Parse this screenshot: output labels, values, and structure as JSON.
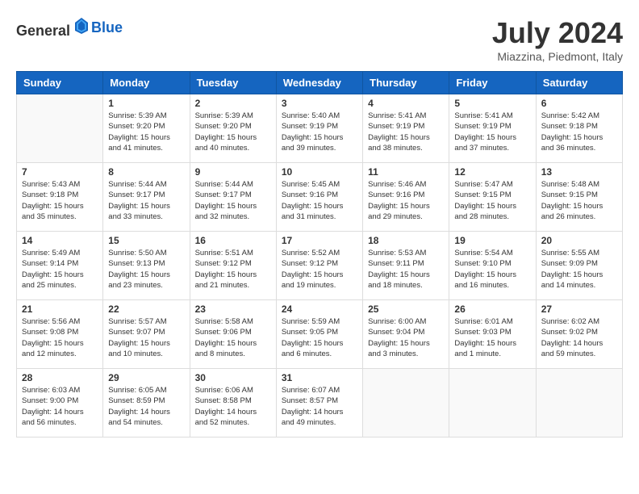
{
  "header": {
    "logo_general": "General",
    "logo_blue": "Blue",
    "month_year": "July 2024",
    "location": "Miazzina, Piedmont, Italy"
  },
  "columns": [
    "Sunday",
    "Monday",
    "Tuesday",
    "Wednesday",
    "Thursday",
    "Friday",
    "Saturday"
  ],
  "weeks": [
    [
      {
        "day": "",
        "info": ""
      },
      {
        "day": "1",
        "info": "Sunrise: 5:39 AM\nSunset: 9:20 PM\nDaylight: 15 hours\nand 41 minutes."
      },
      {
        "day": "2",
        "info": "Sunrise: 5:39 AM\nSunset: 9:20 PM\nDaylight: 15 hours\nand 40 minutes."
      },
      {
        "day": "3",
        "info": "Sunrise: 5:40 AM\nSunset: 9:19 PM\nDaylight: 15 hours\nand 39 minutes."
      },
      {
        "day": "4",
        "info": "Sunrise: 5:41 AM\nSunset: 9:19 PM\nDaylight: 15 hours\nand 38 minutes."
      },
      {
        "day": "5",
        "info": "Sunrise: 5:41 AM\nSunset: 9:19 PM\nDaylight: 15 hours\nand 37 minutes."
      },
      {
        "day": "6",
        "info": "Sunrise: 5:42 AM\nSunset: 9:18 PM\nDaylight: 15 hours\nand 36 minutes."
      }
    ],
    [
      {
        "day": "7",
        "info": "Sunrise: 5:43 AM\nSunset: 9:18 PM\nDaylight: 15 hours\nand 35 minutes."
      },
      {
        "day": "8",
        "info": "Sunrise: 5:44 AM\nSunset: 9:17 PM\nDaylight: 15 hours\nand 33 minutes."
      },
      {
        "day": "9",
        "info": "Sunrise: 5:44 AM\nSunset: 9:17 PM\nDaylight: 15 hours\nand 32 minutes."
      },
      {
        "day": "10",
        "info": "Sunrise: 5:45 AM\nSunset: 9:16 PM\nDaylight: 15 hours\nand 31 minutes."
      },
      {
        "day": "11",
        "info": "Sunrise: 5:46 AM\nSunset: 9:16 PM\nDaylight: 15 hours\nand 29 minutes."
      },
      {
        "day": "12",
        "info": "Sunrise: 5:47 AM\nSunset: 9:15 PM\nDaylight: 15 hours\nand 28 minutes."
      },
      {
        "day": "13",
        "info": "Sunrise: 5:48 AM\nSunset: 9:15 PM\nDaylight: 15 hours\nand 26 minutes."
      }
    ],
    [
      {
        "day": "14",
        "info": "Sunrise: 5:49 AM\nSunset: 9:14 PM\nDaylight: 15 hours\nand 25 minutes."
      },
      {
        "day": "15",
        "info": "Sunrise: 5:50 AM\nSunset: 9:13 PM\nDaylight: 15 hours\nand 23 minutes."
      },
      {
        "day": "16",
        "info": "Sunrise: 5:51 AM\nSunset: 9:12 PM\nDaylight: 15 hours\nand 21 minutes."
      },
      {
        "day": "17",
        "info": "Sunrise: 5:52 AM\nSunset: 9:12 PM\nDaylight: 15 hours\nand 19 minutes."
      },
      {
        "day": "18",
        "info": "Sunrise: 5:53 AM\nSunset: 9:11 PM\nDaylight: 15 hours\nand 18 minutes."
      },
      {
        "day": "19",
        "info": "Sunrise: 5:54 AM\nSunset: 9:10 PM\nDaylight: 15 hours\nand 16 minutes."
      },
      {
        "day": "20",
        "info": "Sunrise: 5:55 AM\nSunset: 9:09 PM\nDaylight: 15 hours\nand 14 minutes."
      }
    ],
    [
      {
        "day": "21",
        "info": "Sunrise: 5:56 AM\nSunset: 9:08 PM\nDaylight: 15 hours\nand 12 minutes."
      },
      {
        "day": "22",
        "info": "Sunrise: 5:57 AM\nSunset: 9:07 PM\nDaylight: 15 hours\nand 10 minutes."
      },
      {
        "day": "23",
        "info": "Sunrise: 5:58 AM\nSunset: 9:06 PM\nDaylight: 15 hours\nand 8 minutes."
      },
      {
        "day": "24",
        "info": "Sunrise: 5:59 AM\nSunset: 9:05 PM\nDaylight: 15 hours\nand 6 minutes."
      },
      {
        "day": "25",
        "info": "Sunrise: 6:00 AM\nSunset: 9:04 PM\nDaylight: 15 hours\nand 3 minutes."
      },
      {
        "day": "26",
        "info": "Sunrise: 6:01 AM\nSunset: 9:03 PM\nDaylight: 15 hours\nand 1 minute."
      },
      {
        "day": "27",
        "info": "Sunrise: 6:02 AM\nSunset: 9:02 PM\nDaylight: 14 hours\nand 59 minutes."
      }
    ],
    [
      {
        "day": "28",
        "info": "Sunrise: 6:03 AM\nSunset: 9:00 PM\nDaylight: 14 hours\nand 56 minutes."
      },
      {
        "day": "29",
        "info": "Sunrise: 6:05 AM\nSunset: 8:59 PM\nDaylight: 14 hours\nand 54 minutes."
      },
      {
        "day": "30",
        "info": "Sunrise: 6:06 AM\nSunset: 8:58 PM\nDaylight: 14 hours\nand 52 minutes."
      },
      {
        "day": "31",
        "info": "Sunrise: 6:07 AM\nSunset: 8:57 PM\nDaylight: 14 hours\nand 49 minutes."
      },
      {
        "day": "",
        "info": ""
      },
      {
        "day": "",
        "info": ""
      },
      {
        "day": "",
        "info": ""
      }
    ]
  ]
}
